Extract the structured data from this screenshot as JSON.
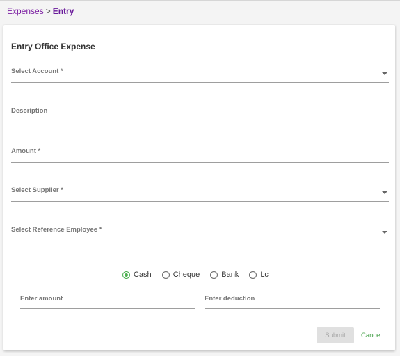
{
  "breadcrumb": {
    "parent": "Expenses",
    "separator": ">",
    "current": "Entry"
  },
  "form": {
    "title": "Entry Office Expense",
    "fields": {
      "account": {
        "label": "Select Account *",
        "value": ""
      },
      "description": {
        "label": "Description",
        "value": ""
      },
      "amount": {
        "label": "Amount *",
        "value": ""
      },
      "supplier": {
        "label": "Select Supplier *",
        "value": ""
      },
      "employee": {
        "label": "Select Reference Employee *",
        "value": ""
      }
    },
    "payment_methods": [
      {
        "label": "Cash",
        "selected": true
      },
      {
        "label": "Cheque",
        "selected": false
      },
      {
        "label": "Bank",
        "selected": false
      },
      {
        "label": "Lc",
        "selected": false
      }
    ],
    "enter_amount": {
      "label": "Enter amount",
      "value": ""
    },
    "enter_deduction": {
      "label": "Enter deduction",
      "value": ""
    },
    "submit_label": "Submit",
    "submit_disabled": true,
    "cancel_label": "Cancel"
  },
  "colors": {
    "accent_purple": "#7b1fa2",
    "radio_green": "#4caf50",
    "cancel_green": "#43a047",
    "disabled_button": "#e0e0e0"
  }
}
